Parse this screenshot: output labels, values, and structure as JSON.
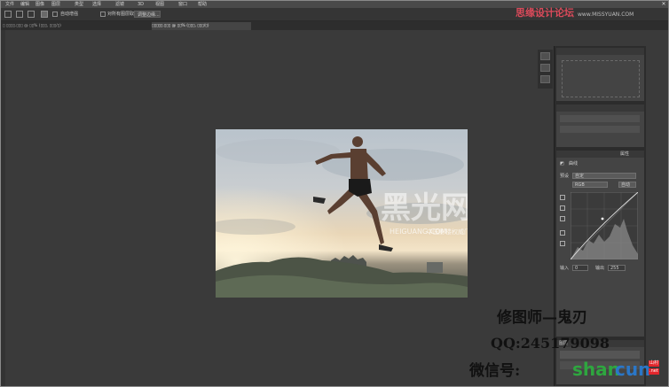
{
  "menubar": {
    "items": [
      "文件",
      "编辑",
      "图像",
      "图层",
      "类型",
      "选择",
      "滤镜",
      "3D",
      "视图",
      "窗口",
      "帮助"
    ]
  },
  "optionsbar": {
    "auto_enhance": "自动增强",
    "sample_all_layers": "对所有图层取样",
    "refine_edge": "调整边缘..."
  },
  "tabs": {
    "tab1": "▯ ▯▯▯▯.▯▯▯ @ ▯▯% (▯▯▯, ▯▯▯/▯)",
    "tab2": "▯▯▯▯▯.▯▯▯ @ ▯▯% (▯▯▯, ▯▯▯/▯)"
  },
  "photo": {
    "watermark_big": "黑光网",
    "watermark_url": "HEIGUANG.COM",
    "watermark_sub": "中国影楼权威门户"
  },
  "panels": {
    "curves_tab": "属性",
    "curves_label": "曲线",
    "preset_label": "预设",
    "preset_value": "自定",
    "channel_label": "RGB",
    "auto_label": "自动",
    "input_label": "输入",
    "output_label": "输出",
    "input_value": "0",
    "output_value": "255",
    "layers_tab": "图层"
  },
  "captions": {
    "line1": "修图师—鬼刃",
    "line2": "QQ:245179098",
    "line3": "微信号:"
  },
  "site_watermarks": {
    "top_cn": "思缘设计论坛",
    "top_url": "www.MISSYUAN.COM",
    "bottom_green": "shan",
    "bottom_blue": "cun",
    "bottom_badge1": "山村",
    "bottom_badge2": ".net"
  },
  "colors": {
    "bg": "#3a3a3a",
    "panel": "#444444",
    "menubar": "#4a4a4a",
    "caption": "#111111"
  }
}
